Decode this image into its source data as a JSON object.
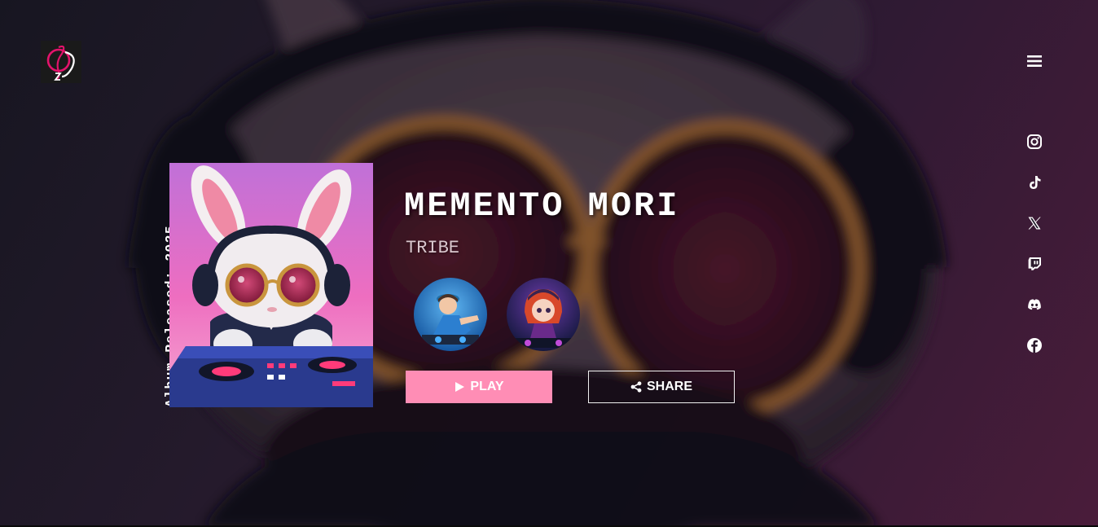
{
  "brand": {
    "logo_icon": "treble-clef-logo-icon",
    "accent": "#e3136b"
  },
  "nav": {
    "menu_icon": "hamburger-menu-icon"
  },
  "socials": [
    {
      "icon": "instagram-icon"
    },
    {
      "icon": "tiktok-icon"
    },
    {
      "icon": "x-twitter-icon"
    },
    {
      "icon": "twitch-icon"
    },
    {
      "icon": "discord-icon"
    },
    {
      "icon": "facebook-icon"
    }
  ],
  "album": {
    "released_text": "Album Released: 2025",
    "title": "MEMENTO MORI",
    "artist": "TRIBE"
  },
  "actions": {
    "play_label": "PLAY",
    "play_icon": "play-icon",
    "share_label": "SHARE",
    "share_icon": "share-icon"
  },
  "colors": {
    "play_button": "#ff8db5",
    "background_dark": "#171621",
    "background_magenta": "#4a1c3a"
  }
}
